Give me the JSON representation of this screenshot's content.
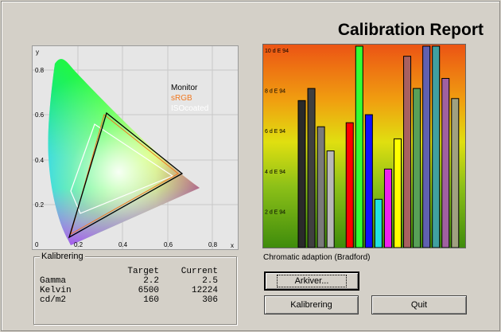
{
  "window": {
    "title": "Calibration Report"
  },
  "gamut_chart": {
    "y_axis_label": "y",
    "x_axis_label": "x",
    "y_ticks": [
      "0.8",
      "0.6",
      "0.4",
      "0.2",
      "0"
    ],
    "x_ticks": [
      "0.2",
      "0.4",
      "0.6",
      "0.8"
    ],
    "legend": [
      {
        "label": "Monitor",
        "color": "#000000"
      },
      {
        "label": "sRGB",
        "color": "#f07820"
      },
      {
        "label": "ISOcoated",
        "color": "#ffffff"
      }
    ]
  },
  "chart_data": {
    "type": "bar",
    "y_tick_labels": [
      "10 d E 94",
      "8 d E 94",
      "6 d E 94",
      "4 d E 94",
      "2 d E 94"
    ],
    "ylim": [
      0,
      10
    ],
    "values": [
      7.3,
      7.9,
      6.0,
      4.8,
      0,
      6.2,
      10.0,
      6.6,
      2.4,
      3.9,
      5.4,
      9.5,
      7.9,
      10.0,
      10.0,
      8.4,
      7.4
    ],
    "colors": [
      "#2a2a2a",
      "#404040",
      "#7a7a7a",
      "#b8b8b8",
      "#000000",
      "#ff0000",
      "#33ff33",
      "#1010ff",
      "#22e0e0",
      "#ee22ee",
      "#ffff00",
      "#a86060",
      "#58a058",
      "#6060b0",
      "#40a0a0",
      "#a060a0",
      "#a0a080"
    ],
    "caption": "Chromatic adaption (Bradford)"
  },
  "calibration": {
    "group_title": "Kalibrering",
    "headers": [
      "",
      "Target",
      "Current"
    ],
    "rows": [
      [
        "Gamma",
        "2.2",
        "2.5"
      ],
      [
        "Kelvin",
        "6500",
        "12224"
      ],
      [
        "cd/m2",
        "160",
        "306"
      ]
    ]
  },
  "buttons": {
    "archive": "Arkiver...",
    "calibrate": "Kalibrering",
    "quit": "Quit"
  }
}
